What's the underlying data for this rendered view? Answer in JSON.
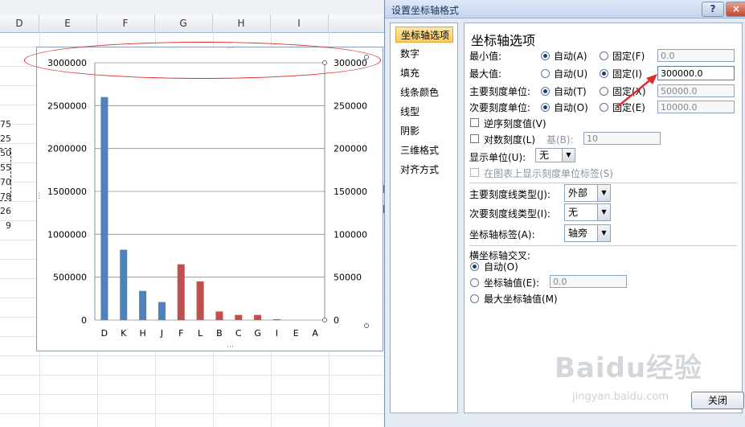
{
  "sheet": {
    "columns": [
      "D",
      "E",
      "F",
      "G",
      "H",
      "I"
    ],
    "row_fragments": [
      "75",
      "25",
      "50",
      "55",
      "70",
      "78",
      "26",
      "9"
    ]
  },
  "chart_data": {
    "type": "bar",
    "categories": [
      "D",
      "K",
      "H",
      "J",
      "F",
      "L",
      "B",
      "C",
      "G",
      "I",
      "E",
      "A"
    ],
    "series": [
      {
        "values": [
          2600000,
          820000,
          340000,
          210000,
          null,
          null,
          null,
          null,
          null,
          null,
          null,
          null
        ],
        "color": "#4f81bd",
        "axis": "primary"
      },
      {
        "values": [
          null,
          null,
          null,
          null,
          65000,
          45000,
          10000,
          6000,
          6000,
          1000,
          0,
          0
        ],
        "color": "#c0504d",
        "axis": "secondary"
      }
    ],
    "primary_ticks": [
      "3000000",
      "2500000",
      "2000000",
      "1500000",
      "1000000",
      "500000",
      "0"
    ],
    "secondary_ticks": [
      "300000",
      "250000",
      "200000",
      "150000",
      "100000",
      "50000",
      "0"
    ],
    "ylim_primary": [
      0,
      3000000
    ],
    "ylim_secondary": [
      0,
      300000
    ],
    "grid": true
  },
  "dialog": {
    "title": "设置坐标轴格式",
    "help": "?",
    "close": "×",
    "nav": [
      "坐标轴选项",
      "数字",
      "填充",
      "线条颜色",
      "线型",
      "阴影",
      "三维格式",
      "对齐方式"
    ],
    "section_title": "坐标轴选项",
    "rows": [
      {
        "label": "最小值:",
        "auto": "自动(A)",
        "fixed": "固定(F)",
        "value": "0.0",
        "selected": "auto"
      },
      {
        "label": "最大值:",
        "auto": "自动(U)",
        "fixed": "固定(I)",
        "value": "300000.0",
        "selected": "fixed"
      },
      {
        "label": "主要刻度单位:",
        "auto": "自动(T)",
        "fixed": "固定(X)",
        "value": "50000.0",
        "selected": "auto"
      },
      {
        "label": "次要刻度单位:",
        "auto": "自动(O)",
        "fixed": "固定(E)",
        "value": "10000.0",
        "selected": "auto"
      }
    ],
    "reverse": "逆序刻度值(V)",
    "log": "对数刻度(L)",
    "base_label": "基(B):",
    "base_value": "10",
    "display_unit_label": "显示单位(U):",
    "display_unit_value": "无",
    "show_unit_label": "在图表上显示刻度单位标签(S)",
    "major_tick_label": "主要刻度线类型(J):",
    "major_tick_value": "外部",
    "minor_tick_label": "次要刻度线类型(I):",
    "minor_tick_value": "无",
    "axis_label_label": "坐标轴标签(A):",
    "axis_label_value": "轴旁",
    "cross_title": "横坐标轴交叉:",
    "cross_auto": "自动(O)",
    "cross_value_label": "坐标轴值(E):",
    "cross_value": "0.0",
    "cross_max": "最大坐标轴值(M)",
    "close_button": "关闭"
  },
  "watermark": {
    "main": "Baidu经验",
    "sub": "jingyan.baidu.com"
  }
}
